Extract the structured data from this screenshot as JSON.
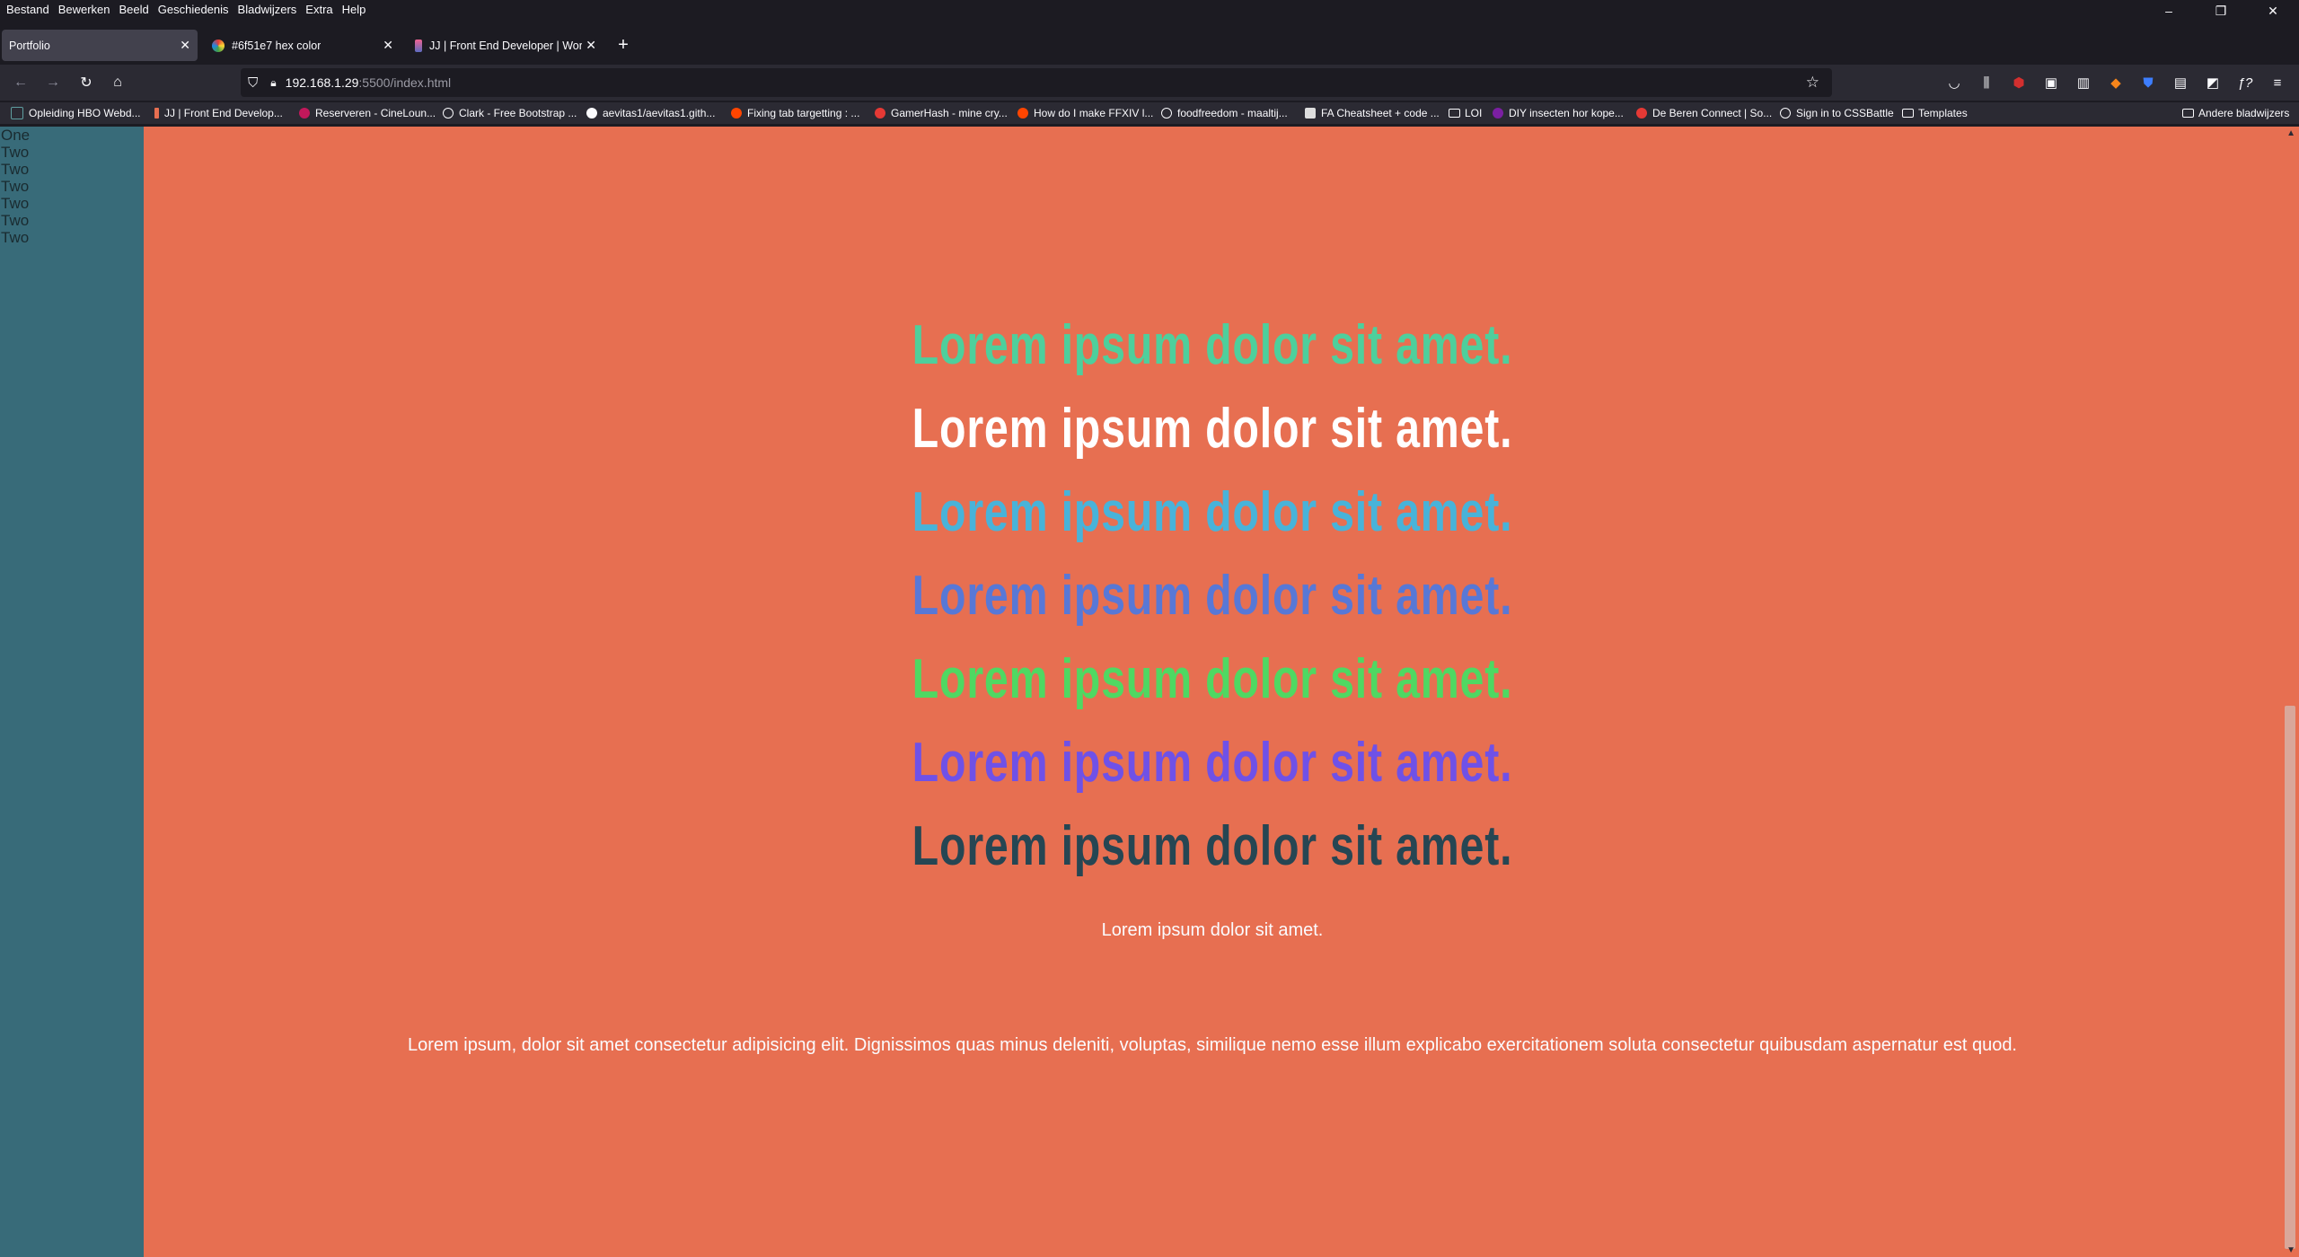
{
  "menu": [
    "Bestand",
    "Bewerken",
    "Beeld",
    "Geschiedenis",
    "Bladwijzers",
    "Extra",
    "Help"
  ],
  "window_controls": {
    "minimize": "–",
    "restore": "❐",
    "close": "✕"
  },
  "tabs": [
    {
      "label": "Portfolio",
      "active": true,
      "close": "✕"
    },
    {
      "label": "#6f51e7 hex color",
      "active": false,
      "close": "✕"
    },
    {
      "label": "JJ | Front End Developer | Word",
      "active": false,
      "close": "✕"
    }
  ],
  "new_tab": "+",
  "nav": {
    "back": "←",
    "forward": "→",
    "reload": "↻",
    "home": "⌂"
  },
  "url": {
    "host": "192.168.1.29",
    "rest": ":5500/index.html",
    "star": "☆"
  },
  "toolbar_icons": [
    "pocket-icon",
    "library-icon",
    "ublock-icon",
    "extension-icon",
    "barcode-icon",
    "metamask-icon",
    "bitwarden-icon",
    "extension2-icon",
    "extension3-icon",
    "formula-icon",
    "menu-icon"
  ],
  "bookmarks": [
    {
      "label": "Opleiding HBO Webd...",
      "color": "#5f9ea0"
    },
    {
      "label": "JJ | Front End Develop...",
      "color": "#e76f51"
    },
    {
      "label": "Reserveren - CineLoun...",
      "color": "#c2185b"
    },
    {
      "label": "Clark - Free Bootstrap ...",
      "color": "#8f8f9d"
    },
    {
      "label": "aevitas1/aevitas1.gith...",
      "color": "#ffffff"
    },
    {
      "label": "Fixing tab targetting : ...",
      "color": "#ff4500"
    },
    {
      "label": "GamerHash - mine cry...",
      "color": "#e53935"
    },
    {
      "label": "How do I make FFXIV l...",
      "color": "#ff4500"
    },
    {
      "label": "foodfreedom - maaltij...",
      "color": "#8f8f9d"
    },
    {
      "label": "FA Cheatsheet + code ...",
      "color": "#dddddd"
    },
    {
      "label": "LOI",
      "folder": true
    },
    {
      "label": "DIY insecten hor kope...",
      "color": "#7b1fa2"
    },
    {
      "label": "De Beren Connect | So...",
      "color": "#e53935"
    },
    {
      "label": "Sign in to CSSBattle",
      "color": "#8f8f9d"
    },
    {
      "label": "Templates",
      "folder": true
    },
    {
      "label": "Andere bladwijzers",
      "folder": true
    }
  ],
  "sidebar": {
    "items": [
      "One",
      "Two",
      "Two",
      "Two",
      "Two",
      "Two",
      "Two"
    ]
  },
  "headlines": [
    {
      "text": "Lorem ipsum dolor sit amet.",
      "color": "#4ecf9c"
    },
    {
      "text": "Lorem ipsum dolor sit amet.",
      "color": "#ffffff"
    },
    {
      "text": "Lorem ipsum dolor sit amet.",
      "color": "#48b3d9"
    },
    {
      "text": "Lorem ipsum dolor sit amet.",
      "color": "#5878d6"
    },
    {
      "text": "Lorem ipsum dolor sit amet.",
      "color": "#4fd862"
    },
    {
      "text": "Lorem ipsum dolor sit amet.",
      "color": "#6f51e7"
    },
    {
      "text": "Lorem ipsum dolor sit amet.",
      "color": "#264653"
    }
  ],
  "subtitle": "Lorem ipsum dolor sit amet.",
  "paragraph": "Lorem ipsum, dolor sit amet consectetur adipisicing elit. Dignissimos quas minus deleniti, voluptas, similique nemo esse illum explicabo exercitationem soluta consectetur quibusdam aspernatur est quod.",
  "colors": {
    "page_bg": "#e76f51",
    "sidebar_bg": "#386b79",
    "chrome_dark": "#1c1b22",
    "chrome_mid": "#2b2a33"
  }
}
